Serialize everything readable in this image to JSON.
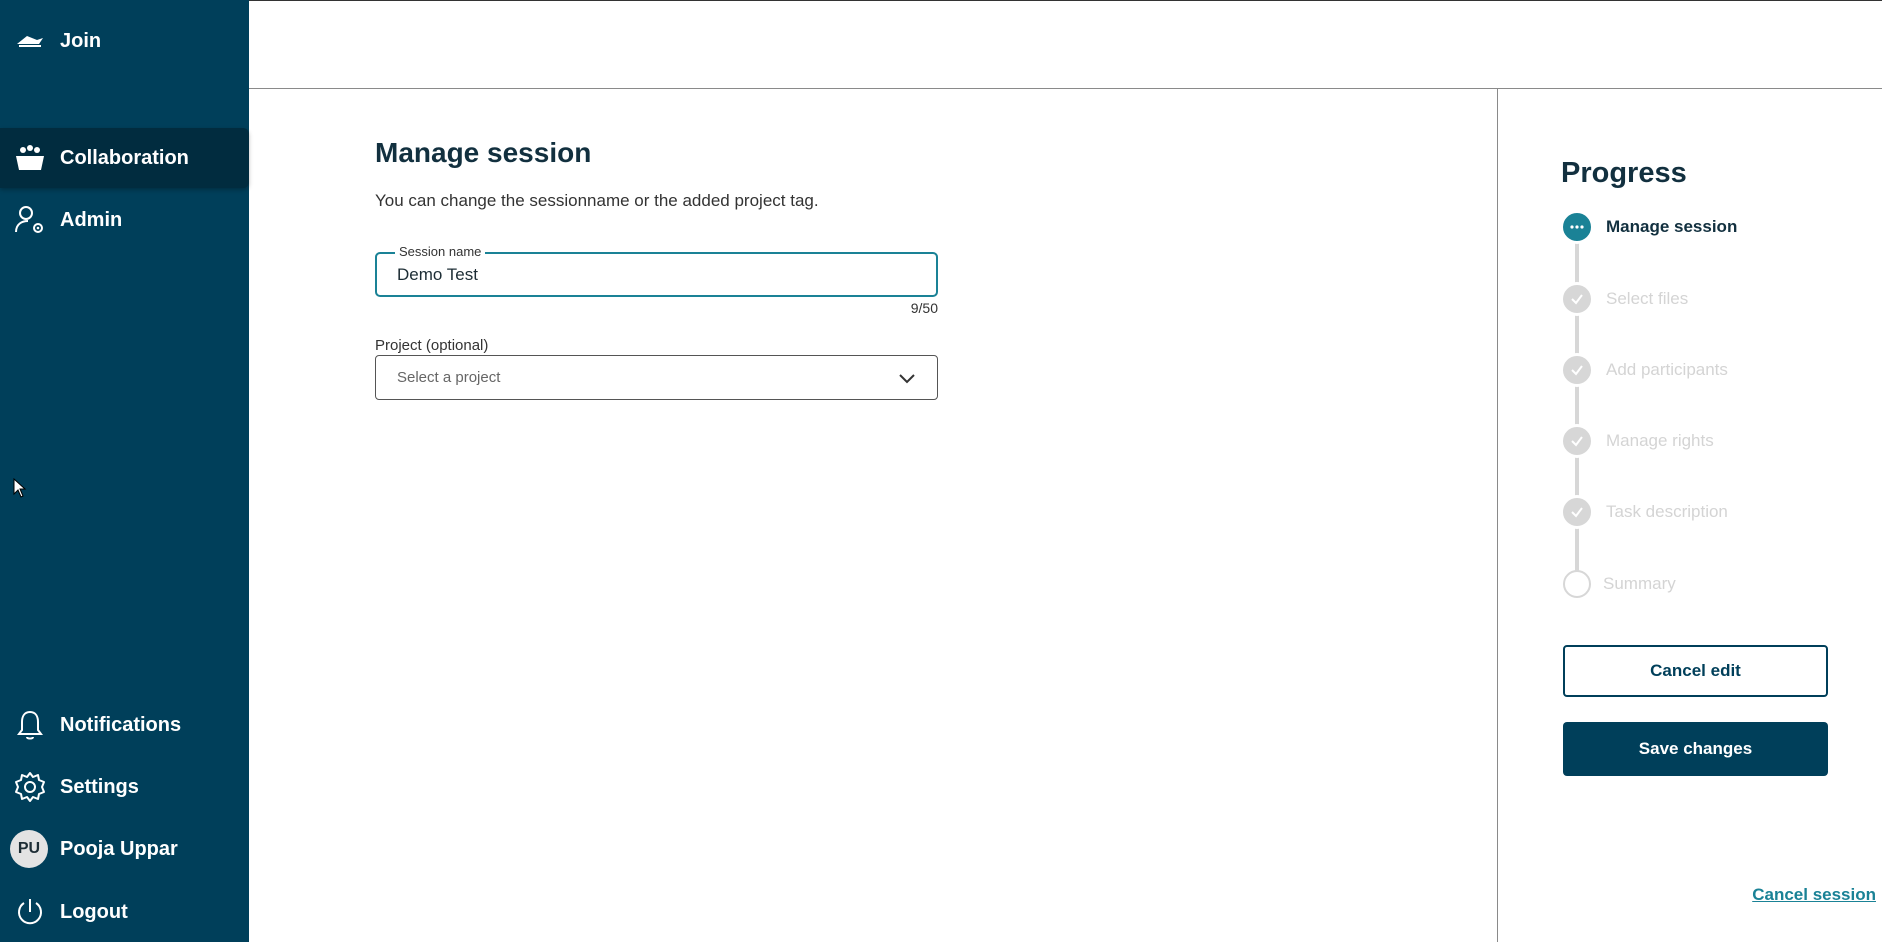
{
  "sidebar": {
    "items": [
      {
        "label": "Join",
        "icon": "join-icon"
      },
      {
        "label": "Collaboration",
        "icon": "collaboration-icon"
      },
      {
        "label": "Admin",
        "icon": "admin-gear-user-icon"
      },
      {
        "label": "Notifications",
        "icon": "bell-icon"
      },
      {
        "label": "Settings",
        "icon": "gear-icon"
      },
      {
        "label": "Pooja Uppar",
        "avatar_initials": "PU"
      },
      {
        "label": "Logout",
        "icon": "power-icon"
      }
    ]
  },
  "main": {
    "title": "Manage session",
    "description": "You can change the sessionname or the added project tag.",
    "session_name": {
      "label": "Session name",
      "value": "Demo Test",
      "counter": "9/50"
    },
    "project": {
      "label": "Project (optional)",
      "placeholder": "Select a project"
    }
  },
  "progress": {
    "title": "Progress",
    "steps": [
      {
        "label": "Manage session",
        "state": "current"
      },
      {
        "label": "Select files",
        "state": "done"
      },
      {
        "label": "Add participants",
        "state": "done"
      },
      {
        "label": "Manage rights",
        "state": "done"
      },
      {
        "label": "Task description",
        "state": "done"
      },
      {
        "label": "Summary",
        "state": "pending"
      }
    ],
    "cancel_edit_label": "Cancel edit",
    "save_changes_label": "Save changes",
    "cancel_session_label": "Cancel session"
  },
  "colors": {
    "sidebar_bg": "#003f5a",
    "accent": "#1a8296",
    "step_inactive": "#d7d7d7"
  }
}
